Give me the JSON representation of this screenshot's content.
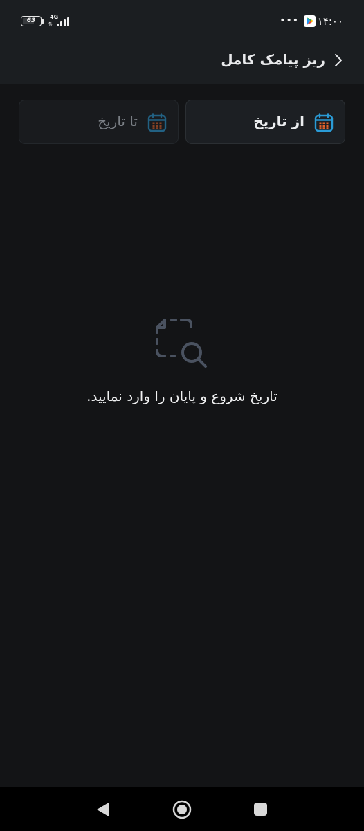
{
  "status_bar": {
    "battery_level": "63",
    "network_type": "4G",
    "signal_strength": 4,
    "time": "۱۴:۰۰",
    "dots": "•••",
    "notification_icon": "google-play-icon"
  },
  "app_bar": {
    "title": "ریز پیامک کامل",
    "back_icon": "chevron-right-icon"
  },
  "date_range": {
    "from_label": "از تاریخ",
    "to_label": "تا تاریخ",
    "icon": "calendar-icon",
    "accent_color": "#2a9bd6",
    "dot_color": "#e0622a"
  },
  "empty_state": {
    "icon": "file-search-icon",
    "message": "تاریخ شروع و پایان را وارد نمایید."
  },
  "nav_bar": {
    "back": "nav-back-icon",
    "home": "nav-home-icon",
    "recents": "nav-recents-icon"
  }
}
